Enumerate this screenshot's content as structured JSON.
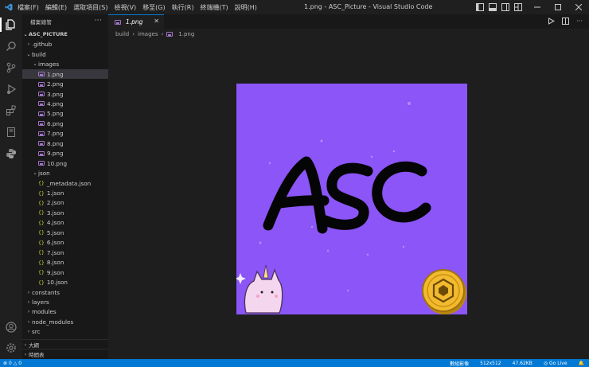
{
  "window": {
    "title": "1.png - ASC_Picture - Visual Studio Code",
    "menu": [
      "檔案(F)",
      "編輯(E)",
      "選取項目(S)",
      "檢視(V)",
      "移至(G)",
      "執行(R)",
      "終端機(T)",
      "說明(H)"
    ]
  },
  "explorer": {
    "header": "檔案總管",
    "more": "···",
    "root": "ASC_PICTURE",
    "items": [
      {
        "label": ".github",
        "type": "folder",
        "depth": 1,
        "open": false
      },
      {
        "label": "build",
        "type": "folder",
        "depth": 1,
        "open": true
      },
      {
        "label": "images",
        "type": "folder",
        "depth": 2,
        "open": true
      },
      {
        "label": "1.png",
        "type": "png",
        "depth": 3,
        "selected": true
      },
      {
        "label": "2.png",
        "type": "png",
        "depth": 3
      },
      {
        "label": "3.png",
        "type": "png",
        "depth": 3
      },
      {
        "label": "4.png",
        "type": "png",
        "depth": 3
      },
      {
        "label": "5.png",
        "type": "png",
        "depth": 3
      },
      {
        "label": "6.png",
        "type": "png",
        "depth": 3
      },
      {
        "label": "7.png",
        "type": "png",
        "depth": 3
      },
      {
        "label": "8.png",
        "type": "png",
        "depth": 3
      },
      {
        "label": "9.png",
        "type": "png",
        "depth": 3
      },
      {
        "label": "10.png",
        "type": "png",
        "depth": 3
      },
      {
        "label": "json",
        "type": "folder",
        "depth": 2,
        "open": true
      },
      {
        "label": "_metadata.json",
        "type": "json",
        "depth": 3
      },
      {
        "label": "1.json",
        "type": "json",
        "depth": 3
      },
      {
        "label": "2.json",
        "type": "json",
        "depth": 3
      },
      {
        "label": "3.json",
        "type": "json",
        "depth": 3
      },
      {
        "label": "4.json",
        "type": "json",
        "depth": 3
      },
      {
        "label": "5.json",
        "type": "json",
        "depth": 3
      },
      {
        "label": "6.json",
        "type": "json",
        "depth": 3
      },
      {
        "label": "7.json",
        "type": "json",
        "depth": 3
      },
      {
        "label": "8.json",
        "type": "json",
        "depth": 3
      },
      {
        "label": "9.json",
        "type": "json",
        "depth": 3
      },
      {
        "label": "10.json",
        "type": "json",
        "depth": 3
      },
      {
        "label": "constants",
        "type": "folder",
        "depth": 1,
        "open": false
      },
      {
        "label": "layers",
        "type": "folder",
        "depth": 1,
        "open": false
      },
      {
        "label": "modules",
        "type": "folder",
        "depth": 1,
        "open": false
      },
      {
        "label": "node_modules",
        "type": "folder",
        "depth": 1,
        "open": false
      },
      {
        "label": "src",
        "type": "folder",
        "depth": 1,
        "open": false
      }
    ],
    "sections": [
      "大綱",
      "時間表"
    ]
  },
  "tab": {
    "label": "1.png",
    "close": "✕"
  },
  "breadcrumb": [
    "build",
    "images",
    "1.png"
  ],
  "image": {
    "text": "ASC",
    "background": "#8b55f7"
  },
  "statusbar": {
    "errors": "0",
    "warnings": "0",
    "binary": "數組影像",
    "dimensions": "512x512",
    "size": "47.62KB",
    "golive": "Go Live"
  },
  "colors": {
    "accent": "#0078d4",
    "image_bg": "#8b55f7",
    "json_icon": "#cbcb41",
    "png_icon": "#a074c4"
  }
}
